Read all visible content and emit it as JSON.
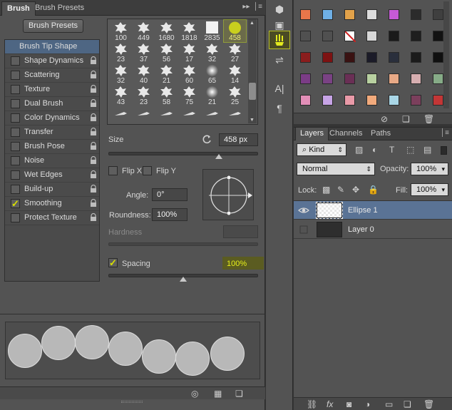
{
  "brush_panel": {
    "tabs": [
      "Brush",
      "Brush Presets"
    ],
    "presets_button": "Brush Presets",
    "settings": [
      {
        "label": "Brush Tip Shape",
        "checked": false,
        "selected": true,
        "has_checkbox": false
      },
      {
        "label": "Shape Dynamics",
        "checked": false
      },
      {
        "label": "Scattering",
        "checked": false
      },
      {
        "label": "Texture",
        "checked": false
      },
      {
        "label": "Dual Brush",
        "checked": false
      },
      {
        "label": "Color Dynamics",
        "checked": false
      },
      {
        "label": "Transfer",
        "checked": false
      },
      {
        "label": "Brush Pose",
        "checked": false
      },
      {
        "label": "Noise",
        "checked": false
      },
      {
        "label": "Wet Edges",
        "checked": false
      },
      {
        "label": "Build-up",
        "checked": false
      },
      {
        "label": "Smoothing",
        "checked": true
      },
      {
        "label": "Protect Texture",
        "checked": false
      }
    ],
    "tips": [
      {
        "size": "100"
      },
      {
        "size": "449"
      },
      {
        "size": "1680"
      },
      {
        "size": "1818"
      },
      {
        "size": "2835"
      },
      {
        "size": "458",
        "selected": true
      },
      {
        "size": "23"
      },
      {
        "size": "37"
      },
      {
        "size": "56"
      },
      {
        "size": "17"
      },
      {
        "size": "32"
      },
      {
        "size": "27"
      },
      {
        "size": "32"
      },
      {
        "size": "40"
      },
      {
        "size": "21"
      },
      {
        "size": "60"
      },
      {
        "size": "65"
      },
      {
        "size": "14"
      },
      {
        "size": "43"
      },
      {
        "size": "23"
      },
      {
        "size": "58"
      },
      {
        "size": "75"
      },
      {
        "size": "21"
      },
      {
        "size": "25"
      },
      {
        "size": ""
      },
      {
        "size": ""
      },
      {
        "size": ""
      },
      {
        "size": ""
      },
      {
        "size": ""
      },
      {
        "size": ""
      }
    ],
    "size_label": "Size",
    "size_value": "458 px",
    "size_level": 0.42,
    "flip_x_label": "Flip X",
    "flip_y_label": "Flip Y",
    "angle_label": "Angle:",
    "angle_value": "0°",
    "roundness_label": "Roundness:",
    "roundness_value": "100%",
    "hardness_label": "Hardness",
    "spacing_label": "Spacing",
    "spacing_value": "100%",
    "spacing_checked": true,
    "spacing_level": 0.5
  },
  "swatches": {
    "rows": [
      [
        "#e7764a",
        "#6fb0e6",
        "#e2a24a",
        "#dddddd",
        "#c65ad6",
        "#2b2b2b",
        "#3f3f3f"
      ],
      [
        "#505050",
        "#505050",
        "#ffffff",
        "#d8d8d8",
        "#1a1a1a",
        "#1e1e1e",
        "#121212"
      ],
      [
        "#8a1d1d",
        "#7d1212",
        "#3a1212",
        "#1b1b28",
        "#2a2f3c",
        "#1b1b1b",
        "#101010"
      ],
      [
        "#7b3c86",
        "#7a4284",
        "#6a2f55",
        "#b8d0a0",
        "#e8a986",
        "#d6aeb0",
        "#86ab87"
      ],
      [
        "#e28fb8",
        "#c7a4e6",
        "#e99aa8",
        "#f2aa7c",
        "#a9d6e6",
        "#7b3f5c",
        "#c33636"
      ]
    ]
  },
  "layers_panel": {
    "tabs": [
      "Layers",
      "Channels",
      "Paths"
    ],
    "filter_kind": "Kind",
    "blend_mode": "Normal",
    "opacity_label": "Opacity:",
    "opacity_value": "100%",
    "lock_label": "Lock:",
    "fill_label": "Fill:",
    "fill_value": "100%",
    "layers": [
      {
        "name": "Ellipse 1",
        "visible": true,
        "selected": true
      },
      {
        "name": "Layer 0",
        "visible": false,
        "selected": false
      }
    ]
  },
  "colors": {
    "accent_yellow": "#d8e000",
    "selection_blue": "#4e6683"
  }
}
